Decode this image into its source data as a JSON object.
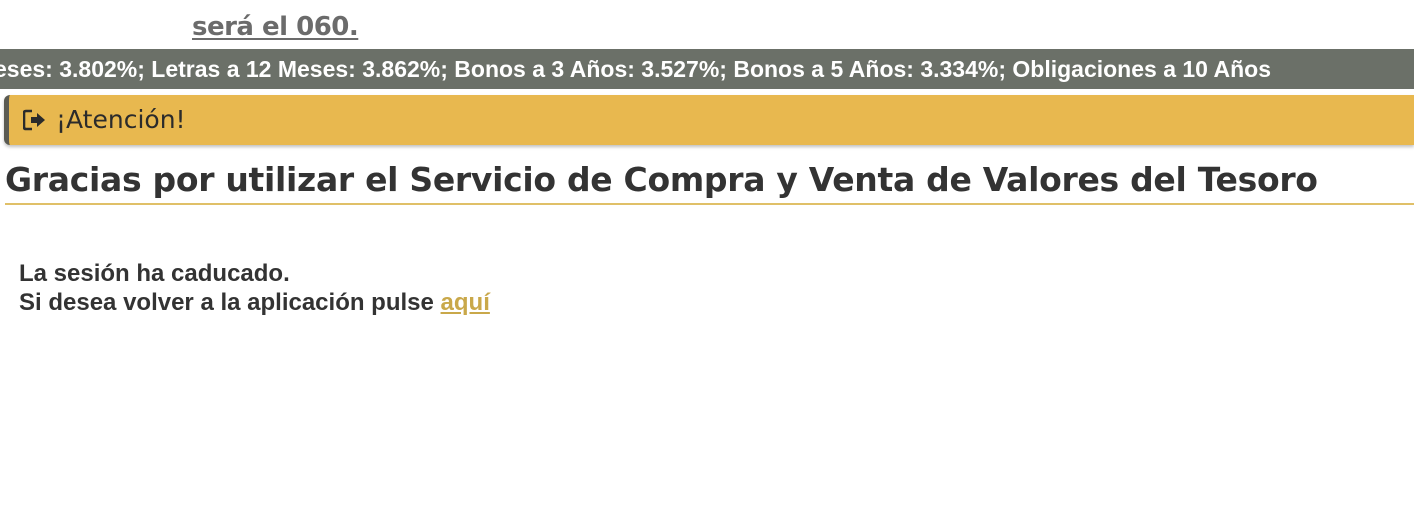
{
  "top_notice": {
    "text": "será el 060."
  },
  "ticker": {
    "text": "eses: 3.802%; Letras a 12 Meses: 3.862%; Bonos a 3 Años: 3.527%; Bonos a 5 Años: 3.334%; Obligaciones a 10 Años"
  },
  "alert": {
    "icon": "sign-out-icon",
    "title": "¡Atención!"
  },
  "page": {
    "title": "Gracias por utilizar el Servicio de Compra y Venta de Valores del Tesoro"
  },
  "message": {
    "line1": "La sesión ha caducado.",
    "line2_prefix": "Si desea volver a la aplicación pulse ",
    "link_label": "aquí"
  },
  "colors": {
    "ticker_bg": "#6b7068",
    "alert_bg": "#e8b84f",
    "accent_link": "#c9a84a",
    "text": "#333333"
  }
}
